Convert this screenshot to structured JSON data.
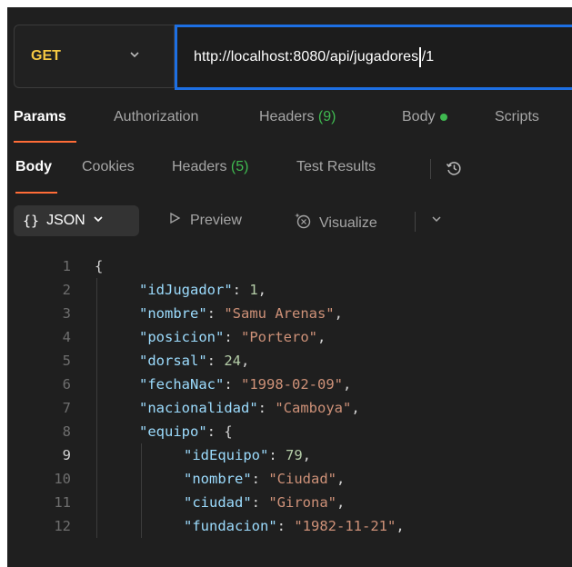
{
  "request": {
    "method": "GET",
    "url_before_cursor": "http://localhost:8080/api/jugadores",
    "url_after_cursor": "/1"
  },
  "request_tabs": [
    {
      "label": "Params",
      "active": true
    },
    {
      "label": "Authorization"
    },
    {
      "label": "Headers ",
      "count": "(9)"
    },
    {
      "label": "Body"
    },
    {
      "label": "Scripts"
    }
  ],
  "response_tabs": [
    {
      "label": "Body",
      "active": true
    },
    {
      "label": "Cookies"
    },
    {
      "label": "Headers ",
      "count": "(5)"
    },
    {
      "label": "Test Results"
    }
  ],
  "view": {
    "format_braces": "{}",
    "format_label": "JSON",
    "preview_label": "Preview",
    "visualize_label": "Visualize"
  },
  "code_lines": [
    {
      "n": "1",
      "indent": 0,
      "open": "{"
    },
    {
      "n": "2",
      "indent": 1,
      "key": "\"idJugador\"",
      "num": "1"
    },
    {
      "n": "3",
      "indent": 1,
      "key": "\"nombre\"",
      "str": "\"Samu Arenas\""
    },
    {
      "n": "4",
      "indent": 1,
      "key": "\"posicion\"",
      "str": "\"Portero\""
    },
    {
      "n": "5",
      "indent": 1,
      "key": "\"dorsal\"",
      "num": "24"
    },
    {
      "n": "6",
      "indent": 1,
      "key": "\"fechaNac\"",
      "str": "\"1998-02-09\""
    },
    {
      "n": "7",
      "indent": 1,
      "key": "\"nacionalidad\"",
      "str": "\"Camboya\""
    },
    {
      "n": "8",
      "indent": 1,
      "key": "\"equipo\"",
      "open": "{"
    },
    {
      "n": "9",
      "indent": 2,
      "key": "\"idEquipo\"",
      "num": "79",
      "current": true
    },
    {
      "n": "10",
      "indent": 2,
      "key": "\"nombre\"",
      "str": "\"Ciudad\""
    },
    {
      "n": "11",
      "indent": 2,
      "key": "\"ciudad\"",
      "str": "\"Girona\""
    },
    {
      "n": "12",
      "indent": 2,
      "key": "\"fundacion\"",
      "str": "\"1982-11-21\""
    }
  ],
  "colors": {
    "accent": "#ff6c37",
    "url_focus_border": "#1d6fe3",
    "method_get": "#f5c842",
    "count_green": "#3fb950"
  },
  "icons": {
    "method_dropdown": "chevron-down-icon",
    "history": "history-icon",
    "preview": "play-triangle-icon",
    "visualize": "visualize-sparkle-icon",
    "visualize_dropdown": "chevron-down-icon"
  }
}
